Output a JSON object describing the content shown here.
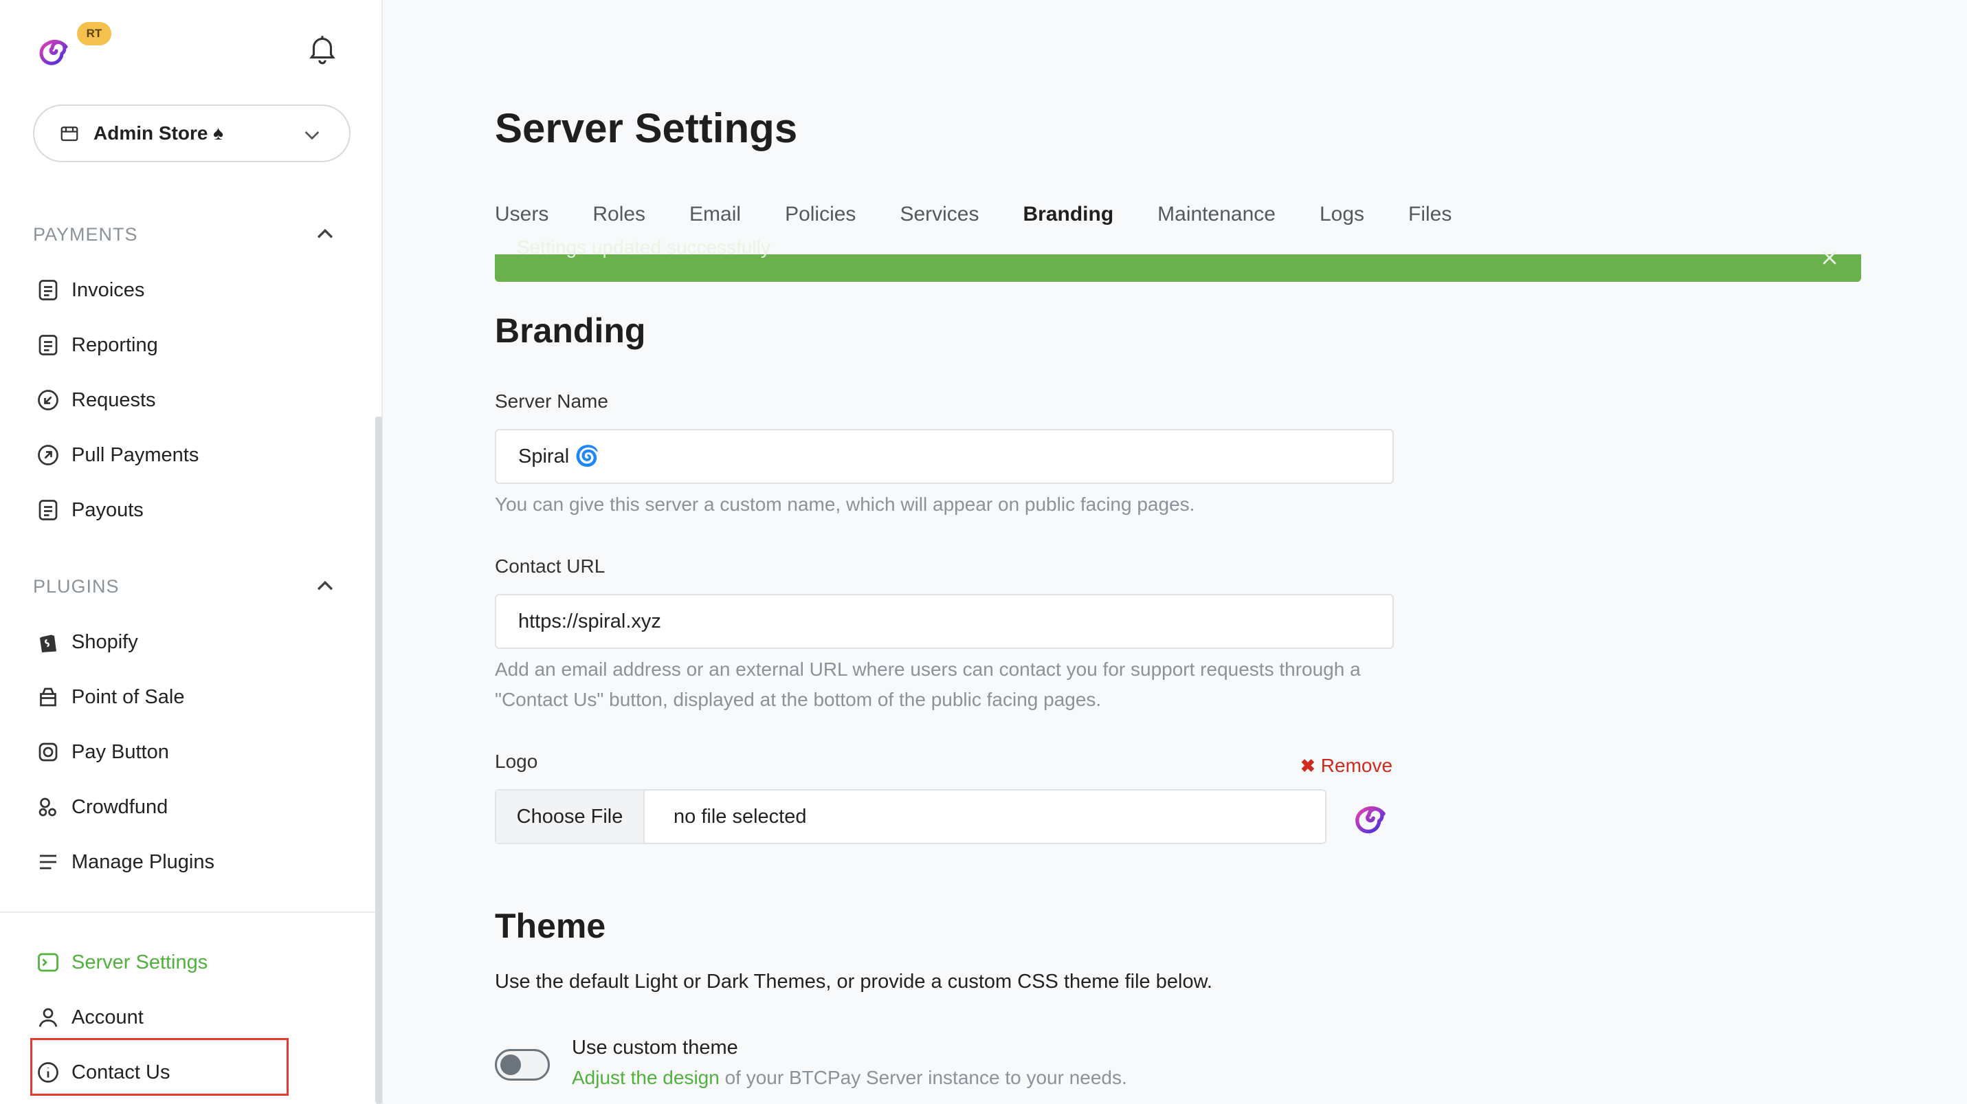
{
  "header": {
    "badge": "RT",
    "store_name": "Admin Store ♠"
  },
  "sidebar": {
    "payments_header": "PAYMENTS",
    "payments": [
      {
        "label": "Invoices",
        "icon": "invoice-icon"
      },
      {
        "label": "Reporting",
        "icon": "report-icon"
      },
      {
        "label": "Requests",
        "icon": "request-icon"
      },
      {
        "label": "Pull Payments",
        "icon": "pull-payment-icon"
      },
      {
        "label": "Payouts",
        "icon": "payout-icon"
      }
    ],
    "plugins_header": "PLUGINS",
    "plugins": [
      {
        "label": "Shopify",
        "icon": "shopify-icon"
      },
      {
        "label": "Point of Sale",
        "icon": "pos-icon"
      },
      {
        "label": "Pay Button",
        "icon": "pay-button-icon"
      },
      {
        "label": "Crowdfund",
        "icon": "crowdfund-icon"
      },
      {
        "label": "Manage Plugins",
        "icon": "list-icon"
      }
    ],
    "bottom": [
      {
        "label": "Server Settings",
        "icon": "server-icon",
        "active": true
      },
      {
        "label": "Account",
        "icon": "user-icon"
      },
      {
        "label": "Contact Us",
        "icon": "info-icon"
      }
    ]
  },
  "main": {
    "title": "Server Settings",
    "tabs": [
      "Users",
      "Roles",
      "Email",
      "Policies",
      "Services",
      "Branding",
      "Maintenance",
      "Logs",
      "Files"
    ],
    "active_tab": "Branding",
    "alert": "Settings updated successfully",
    "branding": {
      "heading": "Branding",
      "server_name_label": "Server Name",
      "server_name_value": "Spiral 🌀",
      "server_name_help": "You can give this server a custom name, which will appear on public facing pages.",
      "contact_url_label": "Contact URL",
      "contact_url_value": "https://spiral.xyz",
      "contact_url_help": "Add an email address or an external URL where users can contact you for support requests through a \"Contact Us\" button, displayed at the bottom of the public facing pages.",
      "logo_label": "Logo",
      "remove_label": "Remove",
      "choose_file": "Choose File",
      "file_status": "no file selected"
    },
    "theme": {
      "heading": "Theme",
      "description": "Use the default Light or Dark Themes, or provide a custom CSS theme file below.",
      "toggle_label": "Use custom theme",
      "toggle_on": false,
      "help_link": "Adjust the design",
      "help_rest": " of your BTCPay Server instance to your needs."
    }
  },
  "colors": {
    "accent": "#51b13e",
    "alert_bg": "#6ab04c",
    "danger": "#d02a1e",
    "badge": "#f4c04e"
  }
}
